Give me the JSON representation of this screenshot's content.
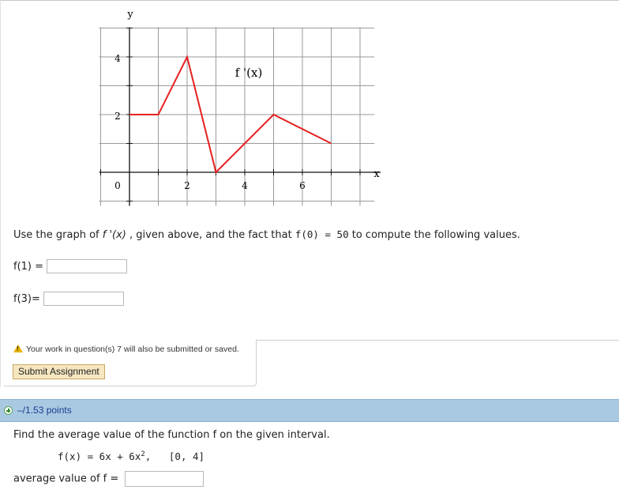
{
  "graph": {
    "y_label": "y",
    "x_label": "x",
    "function_label": "f '(x)",
    "y_ticks": [
      "4",
      "2",
      "0"
    ],
    "x_ticks": [
      "2",
      "4",
      "6"
    ]
  },
  "chart_data": {
    "type": "line",
    "x": [
      0,
      1,
      2,
      3,
      5,
      7
    ],
    "y": [
      2,
      2,
      4,
      0,
      2,
      1
    ],
    "xlim": [
      -1,
      8.5
    ],
    "ylim": [
      -1,
      5
    ],
    "grid": true,
    "xlabel": "x",
    "ylabel": "y",
    "annotation": "f '(x)",
    "line_color": "#e82020"
  },
  "question1": {
    "prompt_prefix": "Use the graph of",
    "prompt_func": "f '(x)",
    "prompt_mid": ", given above, and the fact that",
    "prompt_fact": "f(0) = 50",
    "prompt_suffix": "to compute the following values.",
    "f1_label": "f(1) =",
    "f1_value": "",
    "f3_label": "f(3)=",
    "f3_value": ""
  },
  "notice": {
    "text": "Your work in question(s) 7 will also be submitted or saved."
  },
  "submit": {
    "label": "Submit Assignment"
  },
  "question2": {
    "points": "–/1.53 points",
    "prompt": "Find the average value of the function f on the given interval.",
    "func_left": "f(x) = 6x + 6x",
    "func_exp": "2",
    "func_right": ",",
    "interval": "[0, 4]",
    "answer_label": "average value of f =",
    "answer_value": ""
  },
  "colors": {
    "header_bg": "#a9c9e2",
    "curve": "#e82020",
    "submit_bg": "#f6e7c0"
  }
}
